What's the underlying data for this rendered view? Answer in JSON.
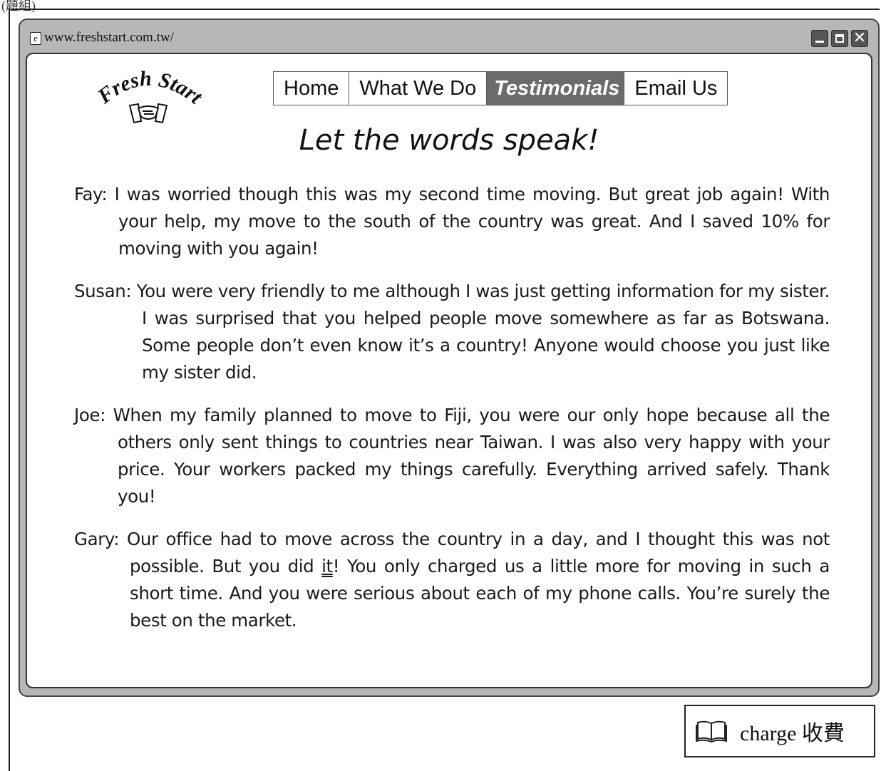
{
  "corner": {
    "label": "(題組)"
  },
  "browser": {
    "url": "www.freshstart.com.tw/",
    "window_buttons": [
      "minimize",
      "maximize",
      "close"
    ]
  },
  "logo": {
    "text": "Fresh Start",
    "icon": "handshake-icon"
  },
  "nav": {
    "items": [
      {
        "label": "Home",
        "active": false
      },
      {
        "label": "What We Do",
        "active": false
      },
      {
        "label": "Testimonials",
        "active": true
      },
      {
        "label": "Email Us",
        "active": false
      }
    ]
  },
  "headline": "Let the words speak!",
  "testimonials": [
    {
      "name": "Fay:",
      "text": "I was worried though this was my second time moving.  But great job again!  With your help, my move to the south of the country was great.  And I saved 10% for moving with you again!"
    },
    {
      "name": "Susan:",
      "text": "You were very friendly to me although I was just getting information for my sister.  I was surprised that you helped people move somewhere as far as Botswana.  Some people don’t even know it’s a country!  Anyone would choose you just like my sister did."
    },
    {
      "name": "Joe:",
      "text": "When my family planned to move to Fiji, you were our only hope because all the others only sent things to countries near Taiwan.  I was also very happy with your price.  Your workers packed my things carefully.  Everything arrived safely.  Thank you!"
    },
    {
      "name": "Gary:",
      "text_before": "Our office had to move across the country in a day, and I thought this was not possible.  But you did ",
      "underlined": "it",
      "text_after": "!  You only charged us a little more for moving in such a short time.  And you were serious about each of my phone calls.  You’re surely the best on the market."
    }
  ],
  "glossary": {
    "icon": "book-icon",
    "text": "charge 收費"
  }
}
